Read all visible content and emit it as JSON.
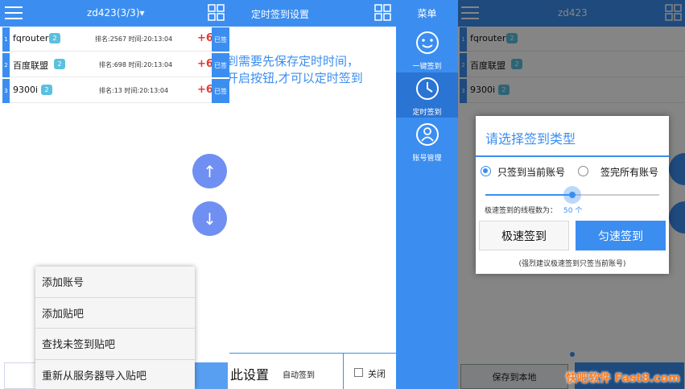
{
  "panel_list": {
    "title": "zd423(3/3)▾",
    "accounts": [
      {
        "index": "1",
        "name": "fqrouter",
        "level": "2",
        "meta": "排名:2567 时间:20:13:04",
        "points": "+6",
        "status": "已签"
      },
      {
        "index": "2",
        "name": "百度联盟",
        "level": "2",
        "meta": "排名:698 时间:20:13:04",
        "points": "+6",
        "status": "已签"
      },
      {
        "index": "3",
        "name": "9300i",
        "level": "2",
        "meta": "排名:13 时间:20:13:04",
        "points": "+6",
        "status": "已签"
      }
    ],
    "scroll_up": "↑",
    "scroll_down": "↓",
    "menu": [
      "添加账号",
      "添加贴吧",
      "查找未签到贴吧",
      "重新从服务器导入贴吧"
    ]
  },
  "panel_timer": {
    "title": "定时签到设置",
    "notice_line1": "到需要先保存定时时间，",
    "notice_line2": "开启按钮,才可以定时签到",
    "footer_title": "此设置",
    "footer_auto": "自动签到",
    "footer_close": "关闭"
  },
  "panel_menu": {
    "title": "菜单",
    "items": [
      {
        "label": "一键签到"
      },
      {
        "label": "定时签到"
      },
      {
        "label": "账号管理"
      }
    ]
  },
  "panel_dialog": {
    "title": "zd423",
    "accounts": [
      {
        "index": "1",
        "name": "fqrouter",
        "level": "2"
      },
      {
        "index": "2",
        "name": "百度联盟",
        "level": "2"
      },
      {
        "index": "3",
        "name": "9300i",
        "level": "2"
      }
    ],
    "dialog_title": "请选择签到类型",
    "option_current": "只签到当前账号",
    "option_all": "签完所有账号",
    "slider_label": "极速签到的线程数为：",
    "slider_value": "50 个",
    "slider_fraction": 0.5,
    "btn_fast": "极速签到",
    "btn_even": "匀速签到",
    "hint": "(强烈建议极速签到只签当前账号)",
    "save_label": "保存到本地",
    "watermark": "快吧软件 Fast8.com"
  },
  "colors": {
    "accent": "#3b8ef0",
    "points": "#e53935",
    "badge": "#5bc0de"
  }
}
